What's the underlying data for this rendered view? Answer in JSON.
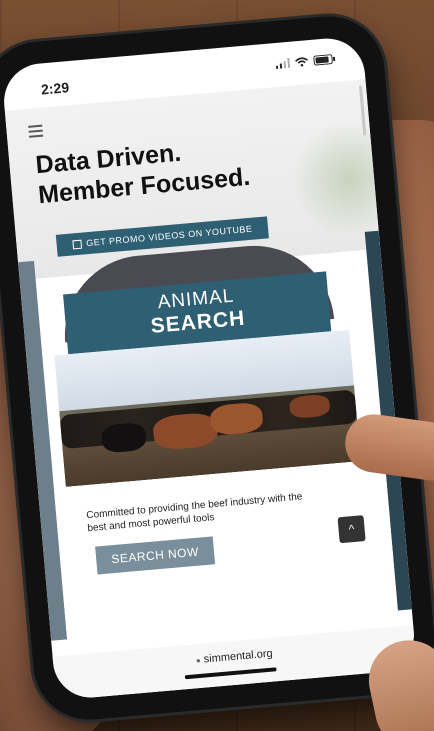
{
  "status_bar": {
    "time": "2:29"
  },
  "hero": {
    "headline_line1": "Data Driven.",
    "headline_line2": "Member Focused.",
    "promo_label": "GET PROMO VIDEOS ON YOUTUBE"
  },
  "banner": {
    "line1": "ANIMAL",
    "line2": "SEARCH"
  },
  "content": {
    "tagline": "Committed to providing the beef industry with the best and most powerful tools",
    "search_button": "SEARCH NOW",
    "scroll_top_symbol": "^"
  },
  "browser": {
    "url": "simmental.org"
  },
  "colors": {
    "brand": "#2f5f73",
    "button_gray": "#7a8f9c"
  }
}
